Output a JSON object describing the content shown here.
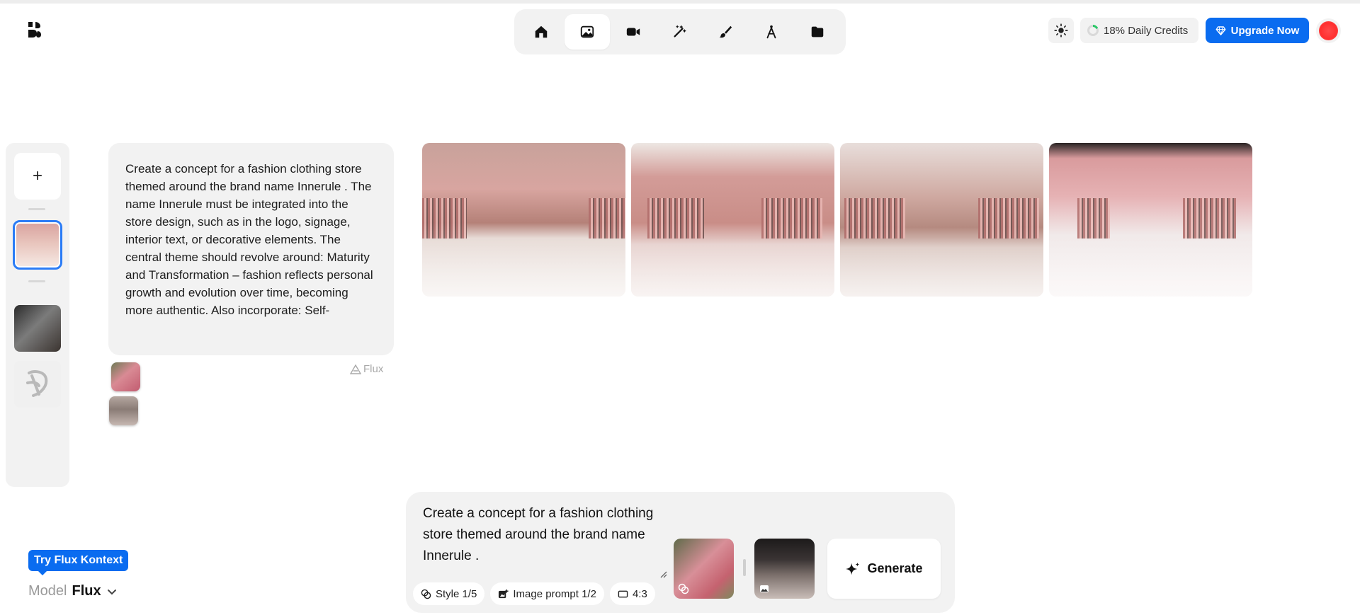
{
  "app": {
    "brand_icon": "app-logo-icon"
  },
  "toolbar": {
    "items": [
      {
        "name": "home",
        "icon": "home-icon",
        "active": false
      },
      {
        "name": "image",
        "icon": "image-icon",
        "active": true
      },
      {
        "name": "video",
        "icon": "video-icon",
        "active": false
      },
      {
        "name": "enhance",
        "icon": "magic-wand-icon",
        "active": false
      },
      {
        "name": "edit",
        "icon": "brush-icon",
        "active": false
      },
      {
        "name": "design",
        "icon": "compass-icon",
        "active": false
      },
      {
        "name": "assets",
        "icon": "folder-icon",
        "active": false
      }
    ]
  },
  "header": {
    "theme_icon": "sun-icon",
    "credits_label": "18% Daily Credits",
    "credits_percent": 18,
    "upgrade_label": "Upgrade Now",
    "upgrade_color": "#0a6cf0"
  },
  "history": {
    "add_label": "+",
    "items": [
      {
        "name": "history-item-store-concept",
        "selected": true
      },
      {
        "name": "history-item-dark-fashion",
        "selected": false
      },
      {
        "name": "history-item-logo-mark",
        "selected": false
      }
    ],
    "selection_color": "#2b7cf6"
  },
  "prompt_bubble": {
    "text": "Create a concept for a fashion clothing store themed around the brand name Innerule . The name Innerule must be integrated into the store design, such as in the logo, signage, interior text, or decorative elements. The central theme should revolve around: Maturity and Transformation – fashion reflects personal growth and evolution over time, becoming more authentic. Also incorporate: Self-",
    "model_label": "Flux"
  },
  "results": {
    "count": 4
  },
  "footer": {
    "promo_label": "Try Flux Kontext",
    "model_label": "Model",
    "model_value": "Flux"
  },
  "composer": {
    "prompt_text": "Create a concept for a fashion clothing store themed around the brand name Innerule .",
    "chips": {
      "style": "Style 1/5",
      "image_prompt": "Image prompt 1/2",
      "ratio": "4:3"
    },
    "generate_label": "Generate"
  }
}
